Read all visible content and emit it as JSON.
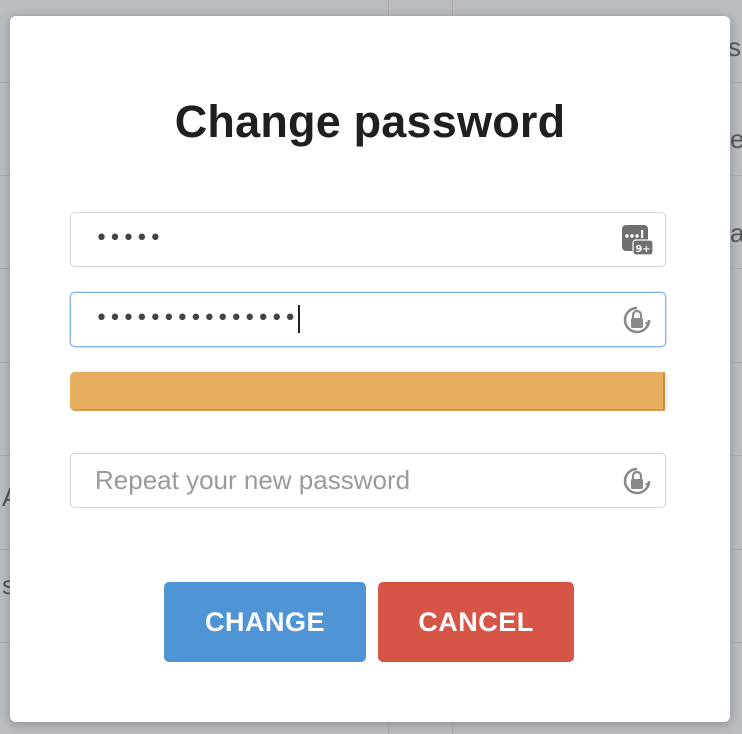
{
  "dialog": {
    "title": "Change password"
  },
  "fields": {
    "current_password": {
      "masked_value": "•••••",
      "icon": "keypad-badge-icon",
      "icon_badge": "9+"
    },
    "new_password": {
      "masked_value": "•••••••••••••••",
      "icon": "lock-reload-icon"
    },
    "repeat_password": {
      "value": "",
      "placeholder": "Repeat your new password",
      "icon": "lock-reload-icon"
    }
  },
  "strength_meter": {
    "level": 0.995,
    "color": "#e6ae5e"
  },
  "buttons": {
    "change_label": "CHANGE",
    "cancel_label": "CANCEL",
    "change_color": "#4f95d6",
    "cancel_color": "#d75546"
  },
  "background": {
    "fragments": [
      "s",
      "e",
      "a",
      "A",
      "s"
    ]
  }
}
